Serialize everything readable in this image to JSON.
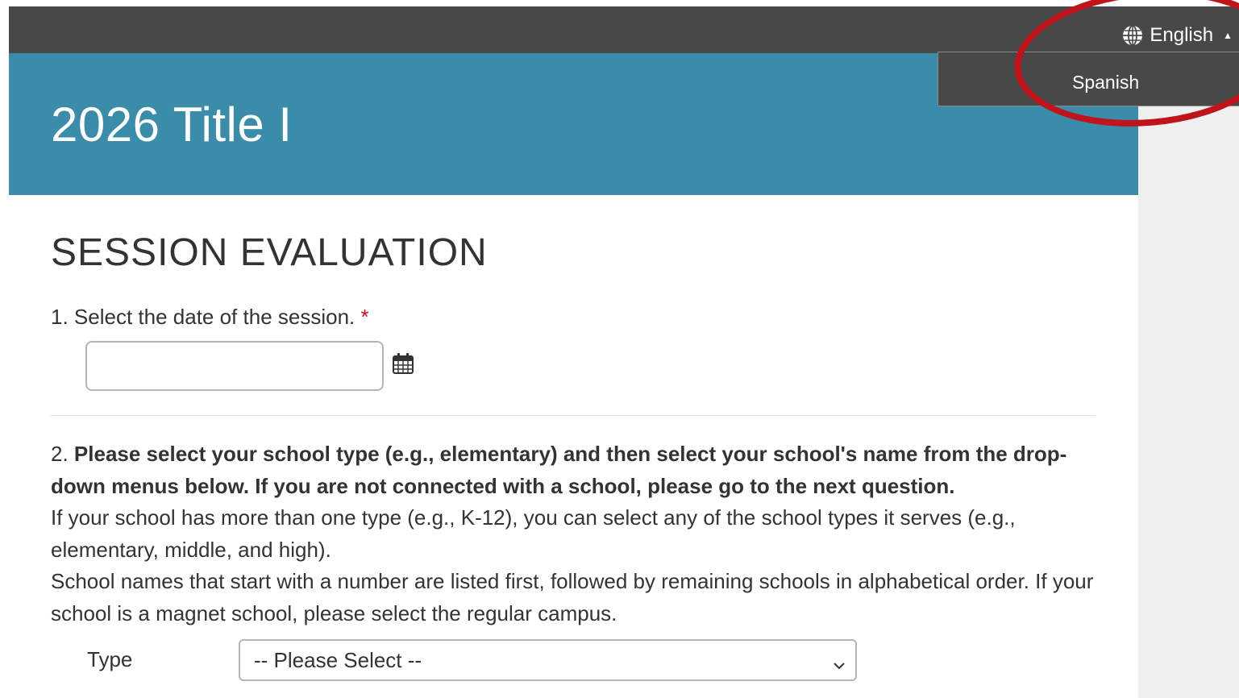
{
  "header": {
    "language": {
      "current": "English",
      "caret": "▲",
      "options": [
        "Spanish"
      ]
    }
  },
  "banner": {
    "title": "2026 Title I"
  },
  "form": {
    "section_title": "SESSION EVALUATION",
    "q1": {
      "number": "1.",
      "label": "Select the date of the session.",
      "required_mark": "*",
      "date_value": ""
    },
    "q2": {
      "number": "2.",
      "bold_text": "Please select your school type (e.g., elementary) and then select your school's name from the drop-down menus below. If you are not connected with a school, please go to the next question.",
      "help_1": "If your school has more than one type (e.g., K-12), you can select any of the school types it serves (e.g., elementary, middle, and high).",
      "help_2": "School names that start with a number are listed first, followed by remaining schools in alphabetical order. If your school is a magnet school, please select the regular campus.",
      "type_label": "Type",
      "type_select_value": "-- Please Select --"
    }
  },
  "colors": {
    "topbar": "#484848",
    "banner": "#3a8ca8",
    "annotation_circle": "#c0141c",
    "required": "#c0141c"
  }
}
